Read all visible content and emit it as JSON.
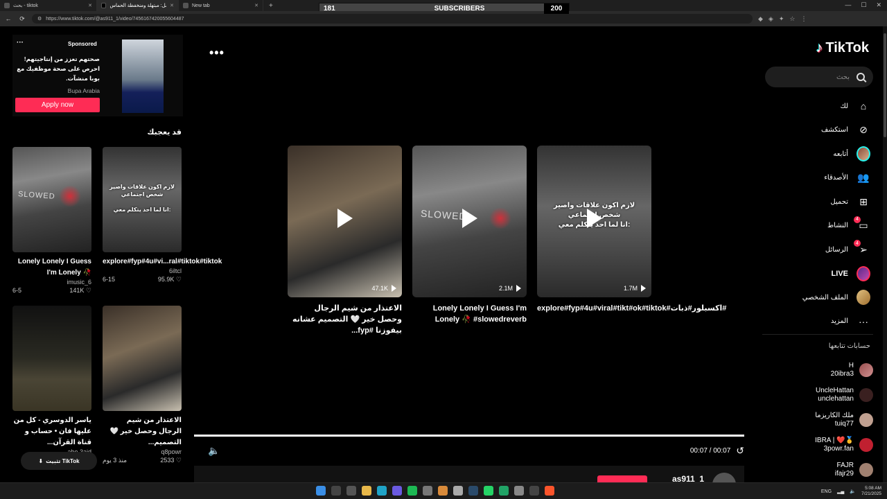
{
  "browser": {
    "tabs": [
      {
        "title": "بحث - tiktok",
        "active": false
      },
      {
        "title": "قال أبو باسل: مبتهلة ومنخفظة الحماس...",
        "active": true
      },
      {
        "title": "New tab",
        "active": false
      }
    ],
    "url": "https://www.tiktok.com/@as911_1/video/7456167420055604487"
  },
  "overlay": {
    "current": "181",
    "label": "SUBSCRIBERS",
    "goal": "200",
    "progress_fraction": 0.905
  },
  "sidebar": {
    "logo_text": "TikTok",
    "search_placeholder": "بحث",
    "items": [
      {
        "label": "لك",
        "icon": "home-icon"
      },
      {
        "label": "استكشف",
        "icon": "compass-icon"
      },
      {
        "label": "أتابعه",
        "icon": "following-avatar-icon"
      },
      {
        "label": "الأصدقاء",
        "icon": "friends-icon"
      },
      {
        "label": "تحميل",
        "icon": "upload-icon"
      },
      {
        "label": "النشاط",
        "icon": "activity-icon",
        "badge": "4"
      },
      {
        "label": "الرسائل",
        "icon": "messages-icon",
        "badge": "4"
      },
      {
        "label": "LIVE",
        "icon": "live-avatar-icon"
      },
      {
        "label": "الملف الشخصي",
        "icon": "profile-avatar-icon"
      },
      {
        "label": "المزيد",
        "icon": "more-icon"
      }
    ],
    "following_title": "حسابات تتابعها",
    "following": [
      {
        "name": "H",
        "handle": "20ibra3"
      },
      {
        "name": "UncleHattan",
        "handle": "unclehattan"
      },
      {
        "name": "ملك الكاريزما",
        "handle": "tuiq77"
      },
      {
        "name": "IBRA | ❤️🥇",
        "handle": "3powr.fan"
      },
      {
        "name": "FAJR",
        "handle": "ifajr29"
      }
    ]
  },
  "stage": {
    "videos": [
      {
        "caption": "الاعتذار من شيم الرجال وحصل خير 🤍 التصميم عشانه بيفوزنا #fyp...",
        "views": "47.1K",
        "overlay": ""
      },
      {
        "caption": "Lonely Lonely I Guess I'm Lonely 🥀 #slowedreverb",
        "views": "2.1M",
        "overlay": "SLOWED"
      },
      {
        "caption": "explore#fyp#4u#viral#tikt#ok#tiktok#اكسبلور#ذبات#",
        "views": "1.7M",
        "overlay": "لازم اكون علاقات واصير شخص اجتماعي\nانا لما احد يتكلم معي:"
      }
    ],
    "time": "00:07 / 00:07",
    "progress_fraction": 1.0,
    "bottom_username": "as911_1"
  },
  "left": {
    "ad": {
      "sponsored": "Sponsored",
      "text": "صحتهم تعزز من إنتاجيتهم! احرص على صحة موظفيك مع بوبا منشآت.",
      "brand": "Bupa Arabia",
      "cta": "Apply now"
    },
    "may_like": "قد يعجبك",
    "cards": [
      {
        "caption": "explore#fyp#4u#vi...ral#tiktok#tiktok",
        "user": "6iltcl",
        "date": "6-15",
        "likes": "95.9K"
      },
      {
        "caption": "Lonely Lonely I Guess I'm Lonely 🥀",
        "user": "imusic_6",
        "date": "6-5",
        "likes": "141K"
      },
      {
        "caption": "الاعتذار من شيم الرجال وحصل خير 🤍 التصميم...",
        "user": "q8powr",
        "date": "منذ 3 يوم",
        "likes": "2533"
      },
      {
        "caption": "ياسر الدوسري - كل من عليها فان • حساب و قناة القرآن...",
        "user": "abo.3aid",
        "date": "",
        "likes": ""
      }
    ],
    "install_pill": "تثبيت TikTok"
  },
  "taskbar": {
    "lang": "ENG",
    "time": "5:08 AM",
    "date": "7/21/2025"
  }
}
